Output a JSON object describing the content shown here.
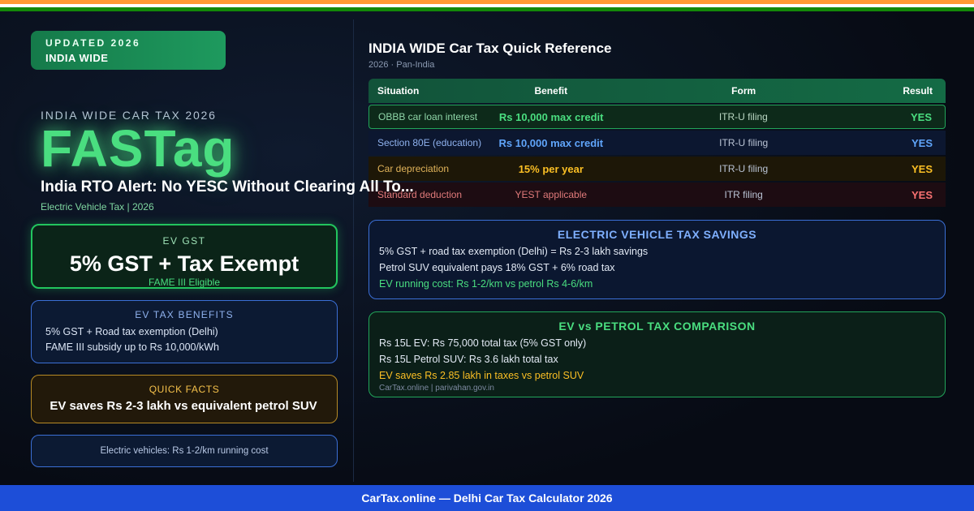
{
  "badge": {
    "line1": "UPDATED 2026",
    "line2": "INDIA WIDE"
  },
  "hero": {
    "kicker": "INDIA WIDE CAR TAX 2026",
    "brand": "FASTag",
    "headline": "India RTO Alert: No YESC Without Clearing All To...",
    "subline": "Electric Vehicle Tax | 2026"
  },
  "cards": {
    "gst": {
      "title": "EV GST",
      "value": "5% GST + Tax Exempt",
      "note": "FAME III Eligible"
    },
    "benefits": {
      "title": "EV TAX BENEFITS",
      "lines": [
        "5% GST + Road tax exemption (Delhi)",
        "FAME III subsidy up to Rs 10,000/kWh"
      ]
    },
    "quick_facts": {
      "title": "QUICK FACTS",
      "value": "EV saves Rs 2-3 lakh vs equivalent petrol SUV"
    },
    "ev_cost": {
      "value": "Electric vehicles: Rs 1-2/km running cost"
    }
  },
  "reference": {
    "title": "INDIA WIDE Car Tax Quick Reference",
    "subtitle": "2026 · Pan-India",
    "columns": [
      "Situation",
      "Benefit",
      "Form",
      "Result"
    ],
    "rows": [
      {
        "situation": "OBBB car loan interest",
        "benefit": "Rs 10,000 max credit",
        "form": "ITR-U filing",
        "result": "YES"
      },
      {
        "situation": "Section 80E (education)",
        "benefit": "Rs 10,000 max credit",
        "form": "ITR-U filing",
        "result": "YES"
      },
      {
        "situation": "Car depreciation",
        "benefit": "15% per year",
        "form": "ITR-U filing",
        "result": "YES"
      },
      {
        "situation": "Standard deduction",
        "benefit": "YEST applicable",
        "form": "ITR filing",
        "result": "YES"
      }
    ]
  },
  "ev_savings": {
    "title": "ELECTRIC VEHICLE TAX SAVINGS",
    "lines": [
      "5% GST + road tax exemption (Delhi) = Rs 2-3 lakh savings",
      "Petrol SUV equivalent pays 18% GST + 6% road tax",
      "EV running cost: Rs 1-2/km vs petrol Rs 4-6/km"
    ]
  },
  "comparison": {
    "title": "EV vs PETROL TAX COMPARISON",
    "lines": [
      "Rs 15L EV: Rs 75,000 total tax (5% GST only)",
      "Rs 15L Petrol SUV: Rs 3.6 lakh total tax",
      "EV saves Rs 2.85 lakh in taxes vs petrol SUV"
    ],
    "source": "CarTax.online | parivahan.gov.in"
  },
  "footer": {
    "text": "CarTax.online — Delhi Car Tax Calculator 2026"
  },
  "colors": {
    "accent_green": "#4ade80",
    "accent_blue": "#60a5fa",
    "accent_gold": "#fbbf24",
    "accent_red": "#f87171",
    "footer_blue": "#1d4ed8"
  }
}
